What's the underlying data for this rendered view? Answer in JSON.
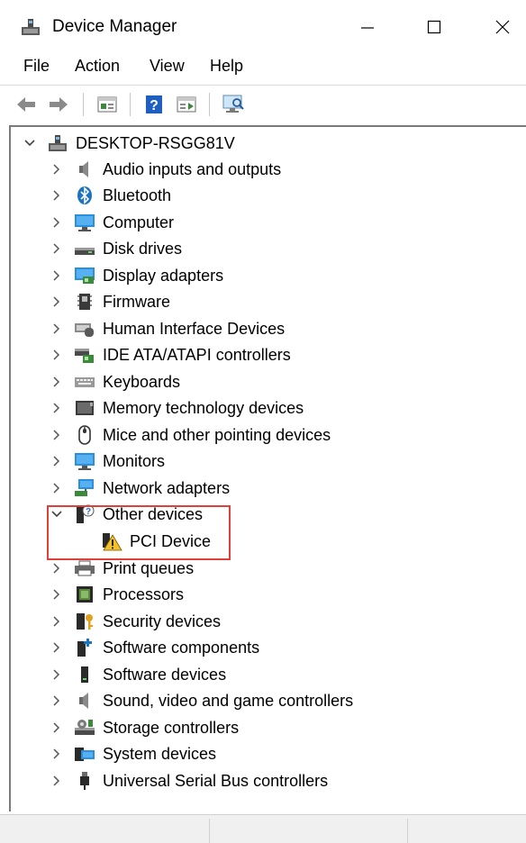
{
  "window": {
    "title": "Device Manager"
  },
  "menu": [
    "File",
    "Action",
    "View",
    "Help"
  ],
  "toolbar": [
    "back-arrow",
    "forward-arrow",
    "show-hide-tree",
    "help",
    "properties",
    "scan-hardware"
  ],
  "tree": {
    "root": "DESKTOP-RSGG81V",
    "categories": [
      {
        "label": "Audio inputs and outputs",
        "icon": "speaker-icon"
      },
      {
        "label": "Bluetooth",
        "icon": "bluetooth-icon"
      },
      {
        "label": "Computer",
        "icon": "computer-icon"
      },
      {
        "label": "Disk drives",
        "icon": "disk-drive-icon"
      },
      {
        "label": "Display adapters",
        "icon": "display-adapter-icon"
      },
      {
        "label": "Firmware",
        "icon": "firmware-icon"
      },
      {
        "label": "Human Interface Devices",
        "icon": "hid-icon"
      },
      {
        "label": "IDE ATA/ATAPI controllers",
        "icon": "ide-controller-icon"
      },
      {
        "label": "Keyboards",
        "icon": "keyboard-icon"
      },
      {
        "label": "Memory technology devices",
        "icon": "memory-device-icon"
      },
      {
        "label": "Mice and other pointing devices",
        "icon": "mouse-icon"
      },
      {
        "label": "Monitors",
        "icon": "monitor-icon"
      },
      {
        "label": "Network adapters",
        "icon": "network-adapter-icon"
      },
      {
        "label": "Other devices",
        "icon": "unknown-device-icon",
        "expanded": true
      },
      {
        "label": "PCI Device",
        "icon": "warning-device-icon",
        "child": true
      },
      {
        "label": "Print queues",
        "icon": "printer-icon"
      },
      {
        "label": "Processors",
        "icon": "processor-icon"
      },
      {
        "label": "Security devices",
        "icon": "security-device-icon"
      },
      {
        "label": "Software components",
        "icon": "software-component-icon"
      },
      {
        "label": "Software devices",
        "icon": "software-device-icon"
      },
      {
        "label": "Sound, video and game controllers",
        "icon": "sound-controller-icon"
      },
      {
        "label": "Storage controllers",
        "icon": "storage-controller-icon"
      },
      {
        "label": "System devices",
        "icon": "system-device-icon"
      },
      {
        "label": "Universal Serial Bus controllers",
        "icon": "usb-icon"
      }
    ]
  },
  "colors": {
    "highlight_border": "#e0403a",
    "accent_blue": "#1e73be"
  }
}
